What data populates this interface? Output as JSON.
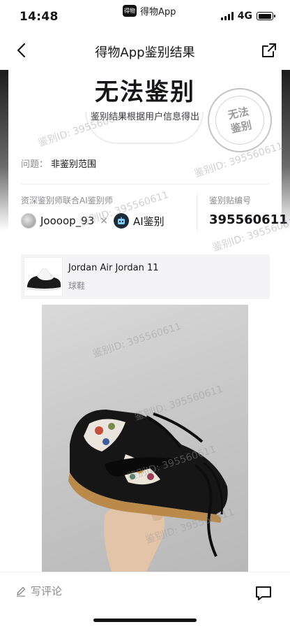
{
  "status_bar": {
    "time": "14:48",
    "app_badge": "得物",
    "app_label": "得物App",
    "network": "4G",
    "battery_level": 0.95,
    "icons": [
      "signal-icon",
      "battery-icon"
    ]
  },
  "nav": {
    "title": "得物App鉴别结果",
    "back_icon": "chevron-left-icon",
    "share_icon": "share-icon"
  },
  "result": {
    "title": "无法鉴别",
    "subtitle": "鉴别结果根据用户信息得出",
    "stamp_text": "无法鉴别"
  },
  "issue": {
    "label": "问题：",
    "value": "非鉴别范围"
  },
  "appraisal": {
    "appraiser_label": "资深鉴别师联合AI鉴别师",
    "appraiser_name": "Joooop_93",
    "times": "×",
    "ai_name": "AI鉴别",
    "code_label": "鉴别贴编号",
    "code_value": "395560611"
  },
  "watermark": "鉴别ID: 395560611",
  "product": {
    "name": "Jordan Air Jordan 11",
    "category": "球鞋"
  },
  "bottom": {
    "comment_label": "写评论",
    "comment_icon": "pencil-icon",
    "message_icon": "message-icon"
  }
}
